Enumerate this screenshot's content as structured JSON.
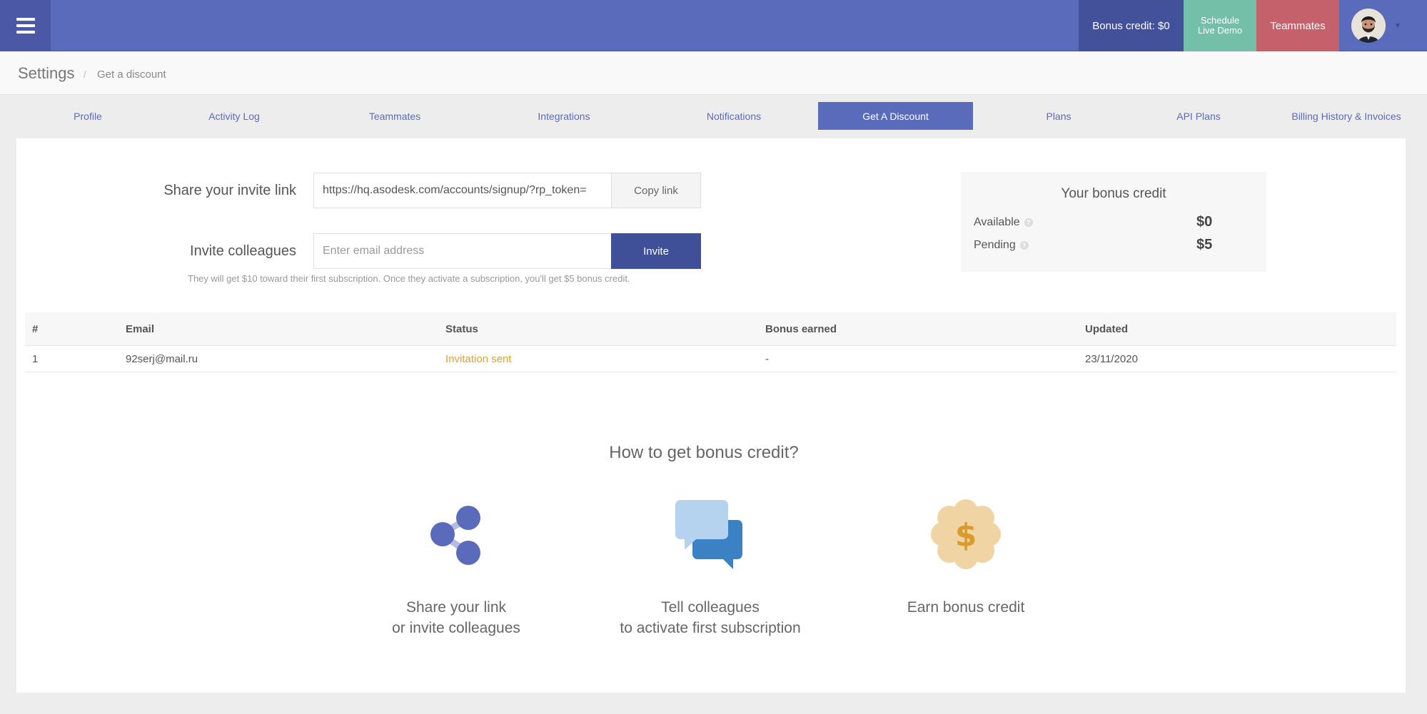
{
  "topbar": {
    "bonus_label": "Bonus credit: $0",
    "demo_line1": "Schedule",
    "demo_line2": "Live Demo",
    "teammates_label": "Teammates",
    "brand_color": "#5b6bbb"
  },
  "breadcrumb": {
    "title": "Settings",
    "separator": "/",
    "current": "Get a discount"
  },
  "tabs": [
    {
      "label": "Profile"
    },
    {
      "label": "Activity Log"
    },
    {
      "label": "Teammates"
    },
    {
      "label": "Integrations"
    },
    {
      "label": "Notifications"
    },
    {
      "label": "Get A Discount",
      "active": true
    },
    {
      "label": "Plans"
    },
    {
      "label": "API Plans"
    },
    {
      "label": "Billing History & Invoices"
    }
  ],
  "invite": {
    "share_label": "Share your invite link",
    "link_value": "https://hq.asodesk.com/accounts/signup/?rp_token=",
    "copy_label": "Copy link",
    "invite_label": "Invite colleagues",
    "email_placeholder": "Enter email address",
    "invite_button": "Invite",
    "hint": "They will get $10 toward their first subscription. Once they activate a subscription, you'll get $5 bonus credit."
  },
  "bonus": {
    "title": "Your bonus credit",
    "available_label": "Available",
    "available_value": "$0",
    "pending_label": "Pending",
    "pending_value": "$5"
  },
  "table": {
    "headers": [
      "#",
      "Email",
      "Status",
      "Bonus earned",
      "Updated"
    ],
    "rows": [
      {
        "num": "1",
        "email": "92serj@mail.ru",
        "status": "Invitation sent",
        "bonus": "-",
        "updated": "23/11/2020"
      }
    ]
  },
  "howto": {
    "title": "How to get bonus credit?",
    "steps": [
      {
        "line1": "Share your link",
        "line2": "or invite colleagues",
        "icon": "share-icon"
      },
      {
        "line1": "Tell colleagues",
        "line2": "to activate first subscription",
        "icon": "chat-bubbles-icon"
      },
      {
        "line1": "Earn bonus credit",
        "line2": "",
        "icon": "dollar-badge-icon"
      }
    ]
  }
}
